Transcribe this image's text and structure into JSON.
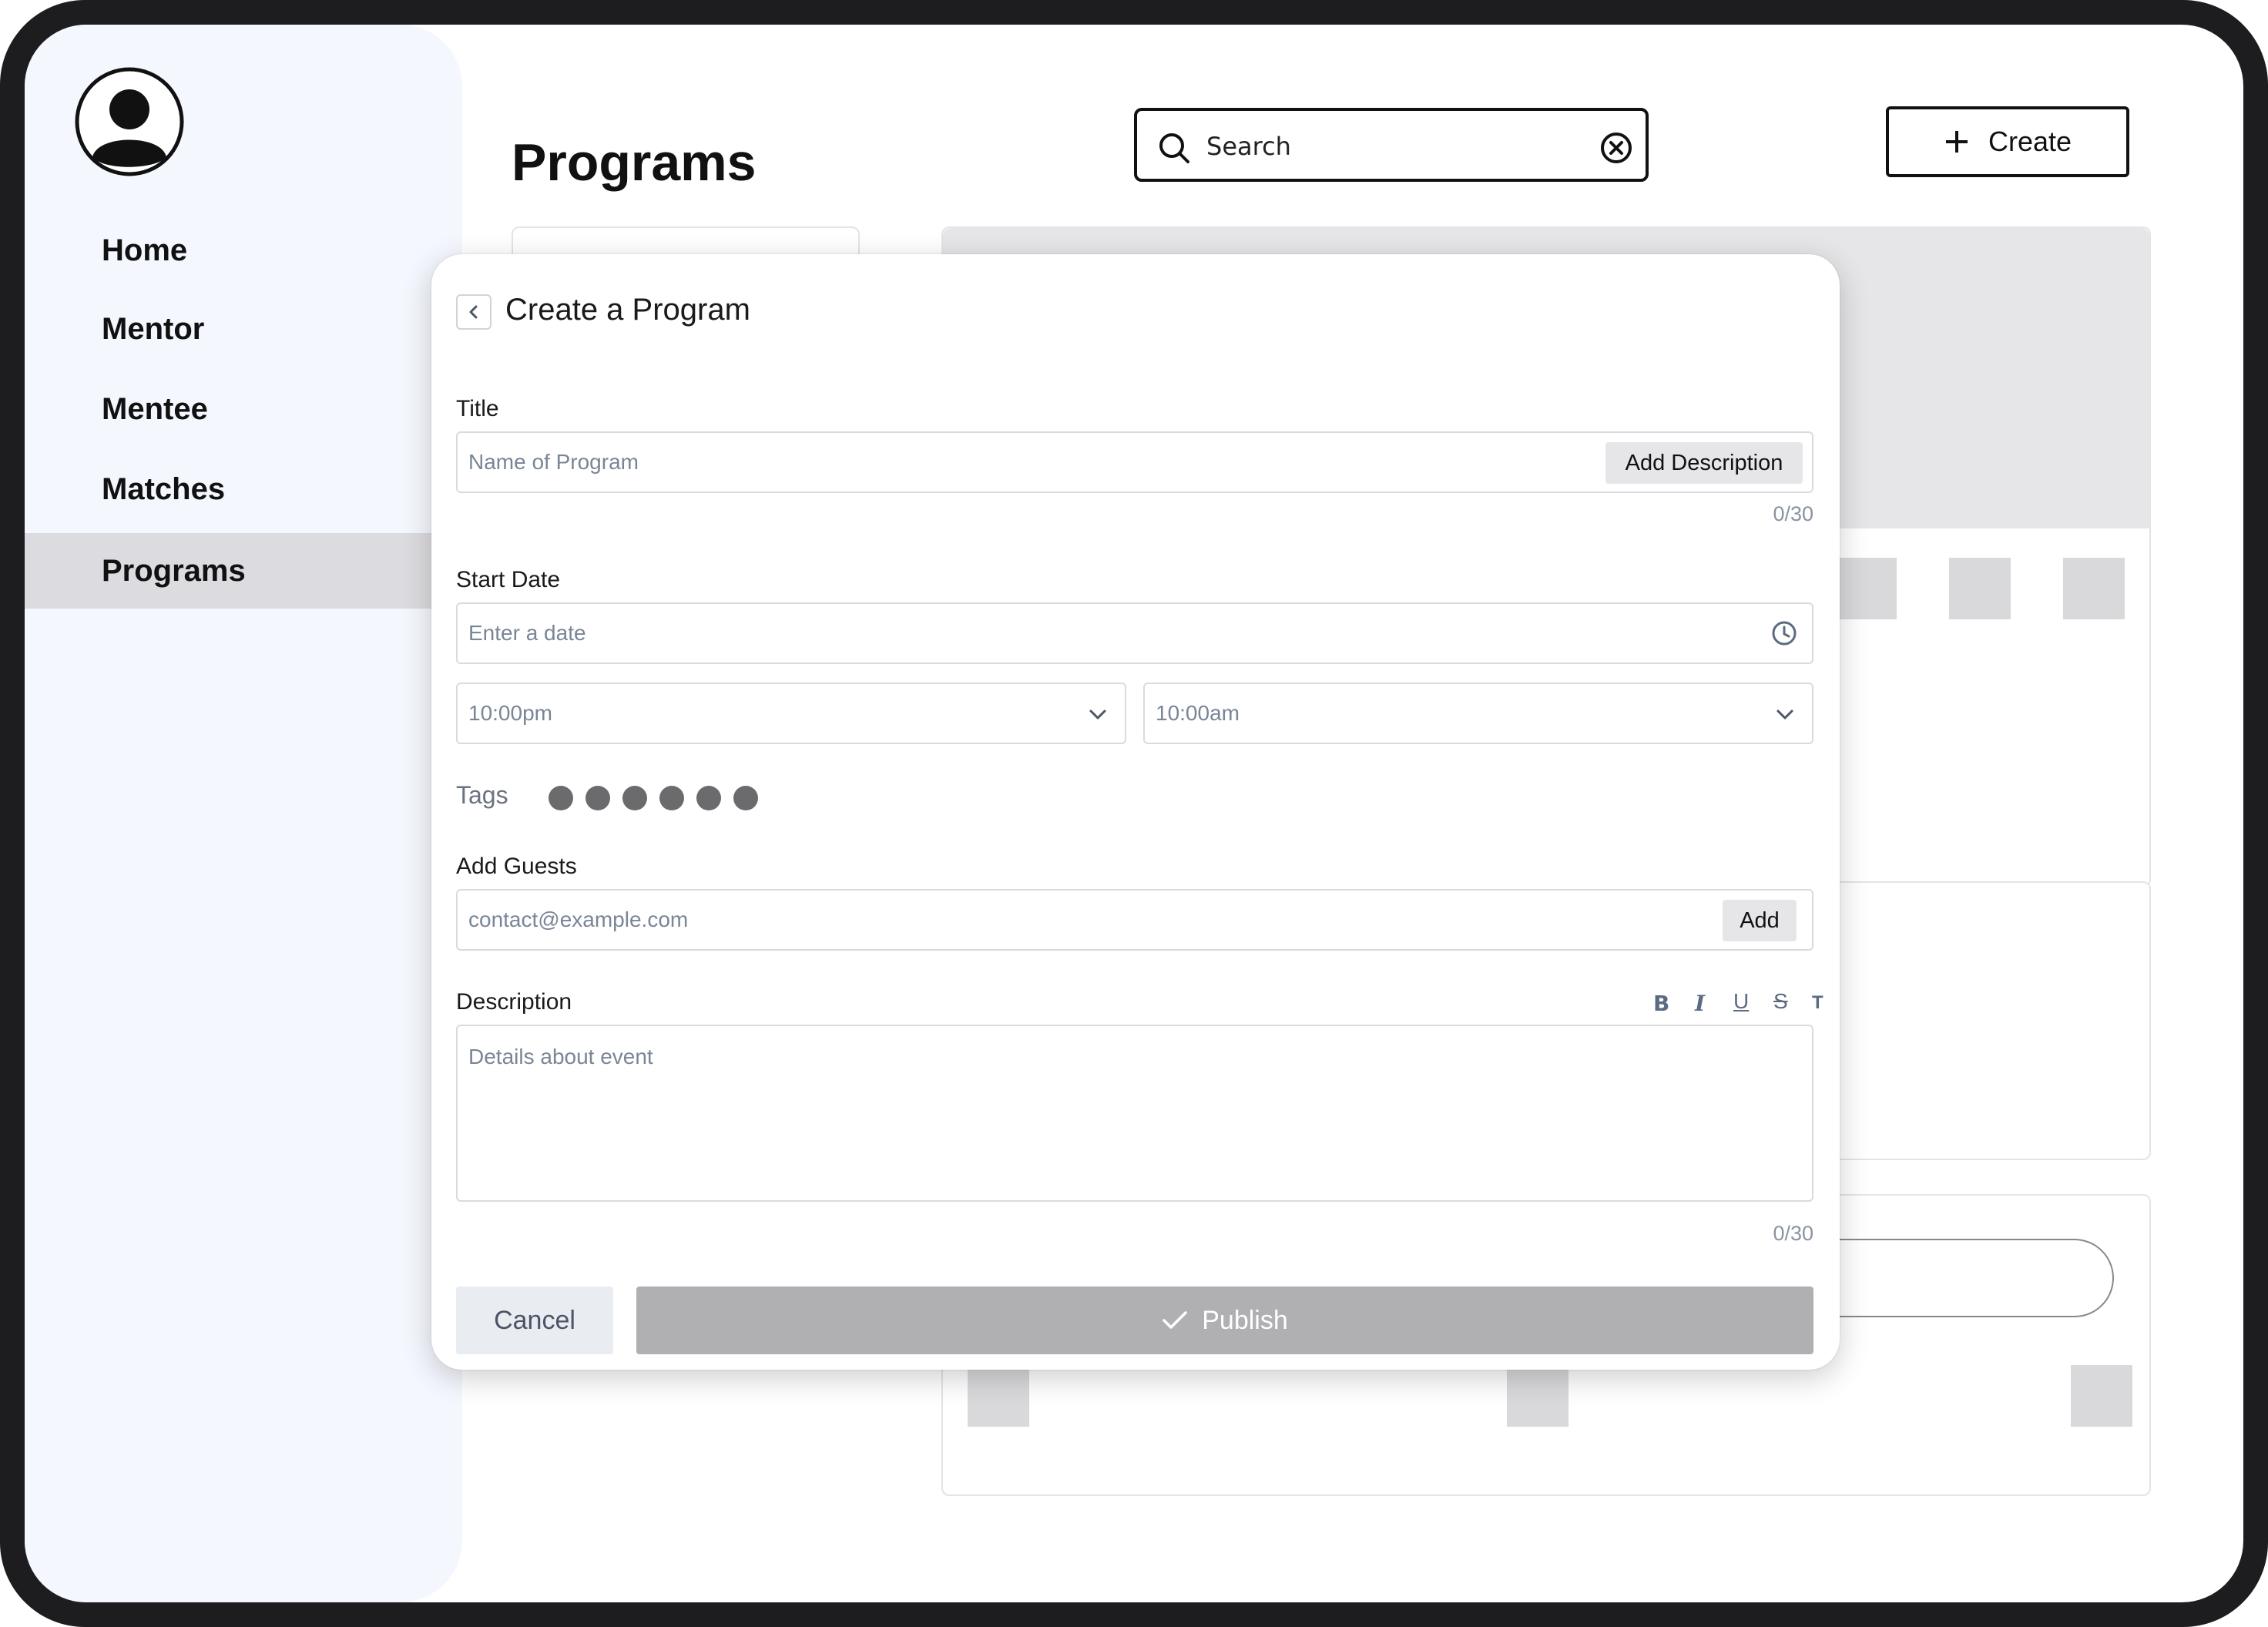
{
  "sidebar": {
    "items": [
      {
        "label": "Home",
        "active": false
      },
      {
        "label": "Mentor",
        "active": false
      },
      {
        "label": "Mentee",
        "active": false
      },
      {
        "label": "Matches",
        "active": false
      },
      {
        "label": "Programs",
        "active": true
      }
    ]
  },
  "header": {
    "title": "Programs",
    "search_placeholder": "Search",
    "create_label": "Create"
  },
  "modal": {
    "title": "Create a Program",
    "title_label": "Title",
    "title_placeholder": "Name of Program",
    "add_description_label": "Add Description",
    "title_counter": "0/30",
    "start_date_label": "Start Date",
    "date_placeholder": "Enter a date",
    "start_time": "10:00pm",
    "end_time": "10:00am",
    "tags_label": "Tags",
    "tag_count": 6,
    "guests_label": "Add Guests",
    "guests_placeholder": "contact@example.com",
    "add_label": "Add",
    "description_label": "Description",
    "description_placeholder": "Details about event",
    "description_counter": "0/30",
    "format_tools": [
      "bold-icon",
      "italic-icon",
      "underline-icon",
      "strikethrough-icon",
      "clear-format-icon"
    ],
    "cancel_label": "Cancel",
    "publish_label": "Publish"
  },
  "colors": {
    "frame": "#1d1d20",
    "sidebar_bg": "#f4f7fd",
    "active_nav_bg": "#dcdbdf",
    "publish_bg": "#b0b0b3",
    "cancel_bg": "#e9ecf1",
    "tag_dot": "#6b6b6e"
  }
}
